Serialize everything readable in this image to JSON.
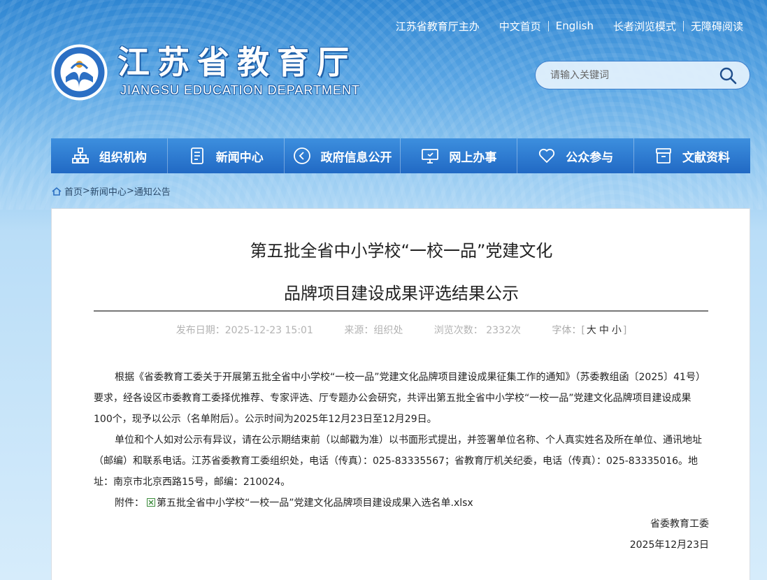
{
  "toplinks": {
    "sponsor": "江苏省教育厅主办",
    "home_cn": "中文首页",
    "english": "English",
    "elder_mode": "长者浏览模式",
    "accessible": "无障碍阅读"
  },
  "logo": {
    "cn": "江苏省教育厅",
    "en": "JIANGSU EDUCATION DEPARTMENT"
  },
  "search": {
    "placeholder": "请输入关键词"
  },
  "nav": [
    {
      "label": "组织机构",
      "icon": "org-chart-icon"
    },
    {
      "label": "新闻中心",
      "icon": "document-icon"
    },
    {
      "label": "政府信息公开",
      "icon": "circle-arrow-icon"
    },
    {
      "label": "网上办事",
      "icon": "monitor-icon"
    },
    {
      "label": "公众参与",
      "icon": "heart-icon"
    },
    {
      "label": "文献资料",
      "icon": "archive-icon"
    }
  ],
  "breadcrumb": {
    "home": "首页",
    "news": "新闻中心",
    "notice": "通知公告",
    "sep": ">"
  },
  "article": {
    "title_line1": "第五批全省中小学校“一校一品”党建文化",
    "title_line2": "品牌项目建设成果评选结果公示",
    "meta": {
      "date": "发布日期：2025-12-23 15:01",
      "source": "来源：组织处",
      "views": "浏览次数：  2332次",
      "font_label": "字体：[",
      "font_big": "大",
      "font_mid": "中",
      "font_small": "小",
      "font_close": "]"
    },
    "para1": "根据《省委教育工委关于开展第五批全省中小学校“一校一品”党建文化品牌项目建设成果征集工作的通知》（苏委教组函〔2025〕41号）要求，经各设区市委教育工委择优推荐、专家评选、厅专题办公会研究，共评出第五批全省中小学校“一校一品”党建文化品牌项目建设成果100个，现予以公示（名单附后）。公示时间为2025年12月23日至12月29日。",
    "para2": "单位和个人如对公示有异议，请在公示期结束前（以邮戳为准）以书面形式提出，并签署单位名称、个人真实姓名及所在单位、通讯地址（邮编）和联系电话。江苏省委教育工委组织处，电话（传真）：025-83335567；省教育厅机关纪委，电话（传真）：025-83335016。地址：南京市北京西路15号，邮编：210024。",
    "attach_label": "附件：",
    "attach_file": "第五批全省中小学校“一校一品”党建文化品牌项目建设成果入选名单.xlsx",
    "signer": "省委教育工委",
    "sign_date": "2025年12月23日"
  }
}
